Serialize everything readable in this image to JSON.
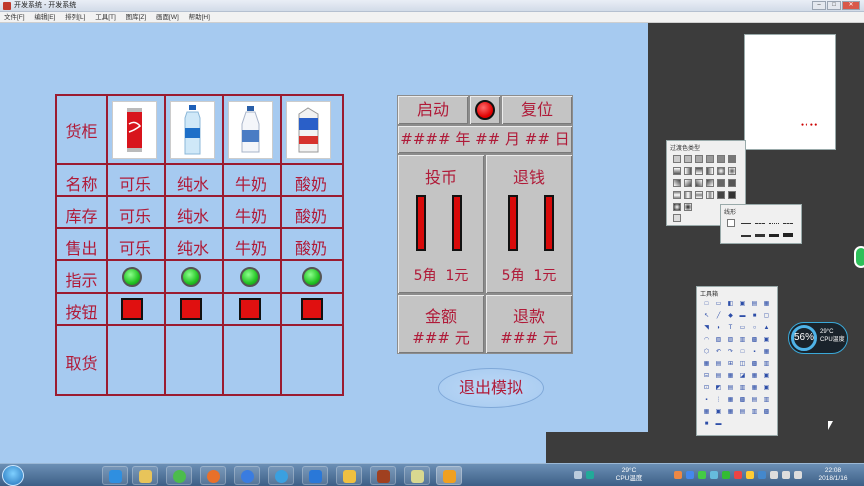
{
  "window": {
    "title": "开发系统 - 开发系统",
    "controls": [
      "minimize",
      "restore",
      "close"
    ]
  },
  "menu": [
    "文件[F]",
    "编辑[E]",
    "排列[L]",
    "工具[T]",
    "图库[Z]",
    "画面[W]",
    "帮助[H]"
  ],
  "vending": {
    "row_labels": [
      "货柜",
      "名称",
      "库存",
      "售出",
      "指示",
      "按钮",
      "取货"
    ],
    "products": [
      {
        "icon": "cola-can-image",
        "name": "可乐",
        "stock": "可乐",
        "sold": "可乐"
      },
      {
        "icon": "water-bottle-image",
        "name": "纯水",
        "stock": "纯水",
        "sold": "纯水"
      },
      {
        "icon": "milk-bottle-image",
        "name": "牛奶",
        "stock": "牛奶",
        "sold": "牛奶"
      },
      {
        "icon": "yogurt-carton-image",
        "name": "酸奶",
        "stock": "酸奶",
        "sold": "酸奶"
      }
    ]
  },
  "control": {
    "start_label": "启动",
    "reset_label": "复位",
    "date_text": "#### 年 ## 月 ## 日",
    "coin_in_label": "投币",
    "coin_out_label": "退钱",
    "coin_in_values": "5角  1元",
    "coin_out_values": "5角  1元",
    "amount_label": "金额",
    "amount_value": "### 元",
    "refund_label": "退款",
    "refund_value": "### 元",
    "exit_label": "退出模拟"
  },
  "tool_windows": {
    "fill_title": "过渡色类型",
    "line_title": "线形",
    "toolbox_title": "工具箱"
  },
  "cpu": {
    "percent": "56%",
    "temp": "29°C",
    "label": "CPU温度"
  },
  "taskbar": {
    "tray_temp": "29°C",
    "tray_label": "CPU温度",
    "time": "22:08",
    "date": "2018/1/16"
  },
  "colors": {
    "accent_text": "#b01a38",
    "grid_line": "#9b1b30",
    "canvas_bg": "#a6caf0",
    "indicator_on": "#22c322",
    "button_red": "#e01010"
  }
}
